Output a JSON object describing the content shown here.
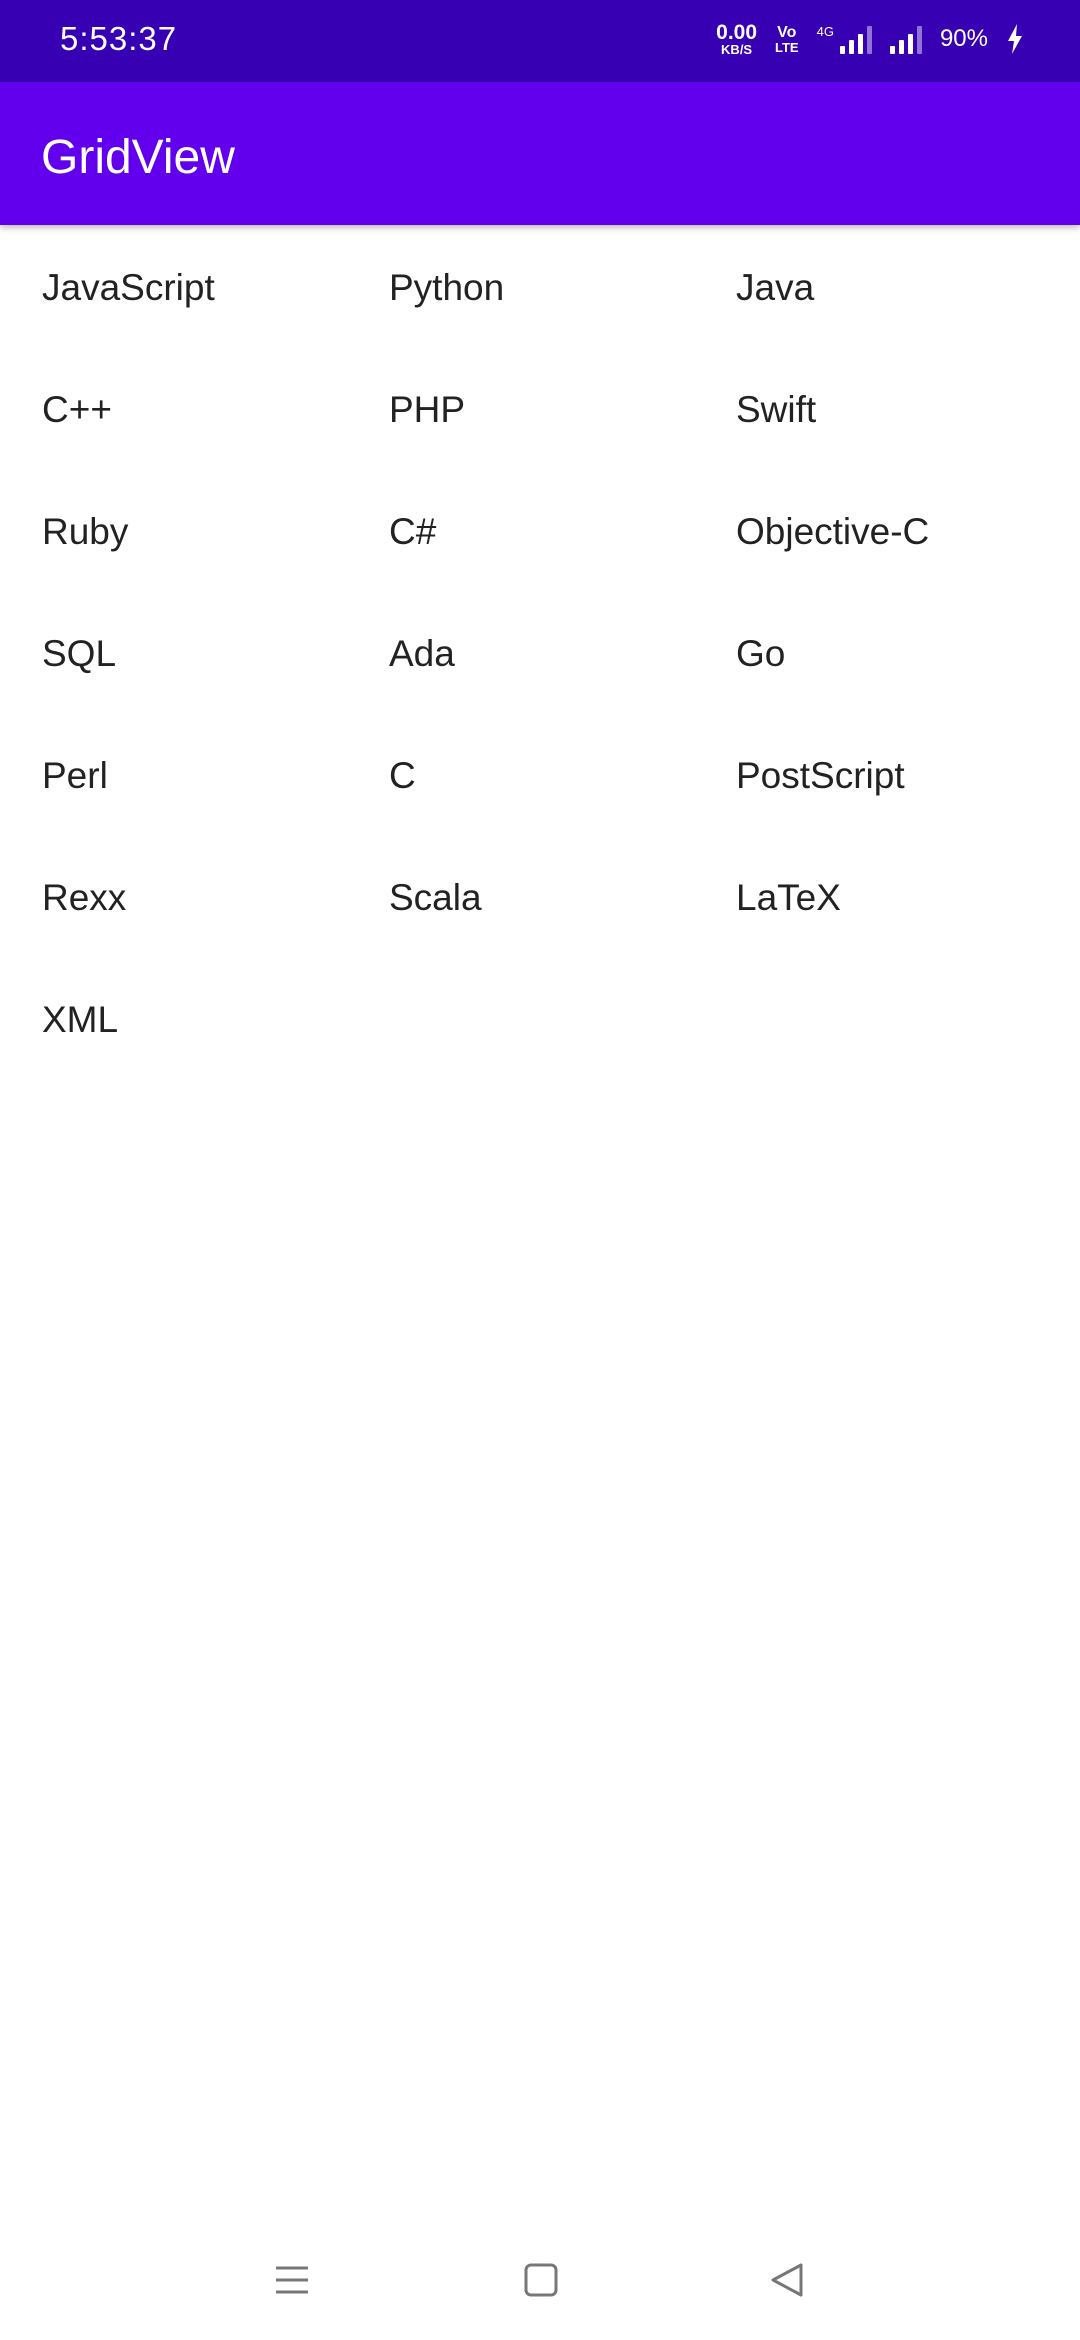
{
  "status_bar": {
    "time": "5:53:37",
    "net_speed_value": "0.00",
    "net_speed_unit": "KB/S",
    "volte_top": "Vo",
    "volte_bottom": "LTE",
    "network_type": "4G",
    "battery": "90%"
  },
  "app_bar": {
    "title": "GridView",
    "color": "#6200ee"
  },
  "grid": {
    "items": [
      "JavaScript",
      "Python",
      "Java",
      "C++",
      "PHP",
      "Swift",
      "Ruby",
      "C#",
      "Objective-C",
      "SQL",
      "Ada",
      "Go",
      "Perl",
      "C",
      "PostScript",
      "Rexx",
      "Scala",
      "LaTeX",
      "XML"
    ]
  },
  "nav_bar": {
    "icons": [
      "menu-icon",
      "home-icon",
      "back-icon"
    ]
  }
}
